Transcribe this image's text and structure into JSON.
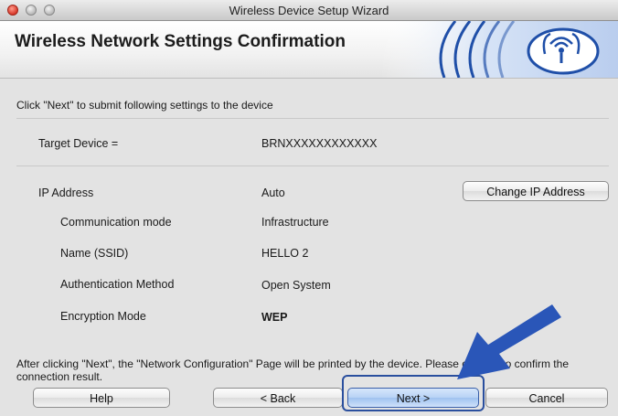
{
  "window": {
    "title": "Wireless Device Setup Wizard"
  },
  "header": {
    "title": "Wireless Network Settings Confirmation"
  },
  "instruction": "Click \"Next\" to submit following settings to the device",
  "target_device": {
    "label": "Target Device =",
    "value": "BRNXXXXXXXXXXXX"
  },
  "settings": [
    {
      "label": "IP Address",
      "value": "Auto"
    },
    {
      "label": "Communication mode",
      "value": "Infrastructure"
    },
    {
      "label": "Name (SSID)",
      "value": "HELLO 2"
    },
    {
      "label": "Authentication Method",
      "value": "Open System"
    },
    {
      "label": "Encryption Mode",
      "value": "WEP"
    }
  ],
  "change_ip_button": "Change IP Address",
  "note": "After clicking \"Next\", the \"Network Configuration\" Page will be printed by the device. Please check it to confirm the connection result.",
  "buttons": {
    "help": "Help",
    "back": "< Back",
    "next": "Next >",
    "cancel": "Cancel"
  },
  "colors": {
    "arrow": "#2a56b8",
    "highlight": "#2a4f9e",
    "header_graphic": "#1f4fa8"
  },
  "icons": {
    "header": "wireless-signal-icon"
  }
}
